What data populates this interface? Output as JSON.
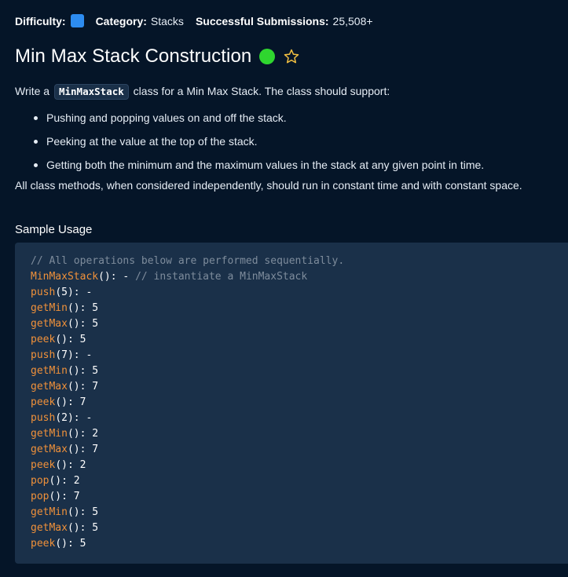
{
  "meta": {
    "difficulty_label": "Difficulty:",
    "category_label": "Category:",
    "category_value": "Stacks",
    "submissions_label": "Successful Submissions:",
    "submissions_value": "25,508+",
    "difficulty_color": "#2d8cf0"
  },
  "title": "Min Max Stack Construction",
  "status": {
    "completed_color": "#2fd62f",
    "favorite_icon": "star-outline-icon",
    "star_color": "#f5c242"
  },
  "description": {
    "intro_before": "Write a",
    "class_name": "MinMaxStack",
    "intro_after": "class for a Min Max Stack. The class should support:",
    "features": [
      "Pushing and popping values on and off the stack.",
      "Peeking at the value at the top of the stack.",
      "Getting both the minimum and the maximum values in the stack at any given point in time."
    ],
    "closing": "All class methods, when considered independently, should run in constant time and with constant space."
  },
  "sample_usage": {
    "heading": "Sample Usage",
    "comment": "// All operations below are performed sequentially.",
    "lines": [
      {
        "fn": "MinMaxStack",
        "result": "-",
        "note": "// instantiate a MinMaxStack"
      },
      {
        "fn": "push",
        "arg": "5",
        "result": "-"
      },
      {
        "fn": "getMin",
        "result": "5"
      },
      {
        "fn": "getMax",
        "result": "5"
      },
      {
        "fn": "peek",
        "result": "5"
      },
      {
        "fn": "push",
        "arg": "7",
        "result": "-"
      },
      {
        "fn": "getMin",
        "result": "5"
      },
      {
        "fn": "getMax",
        "result": "7"
      },
      {
        "fn": "peek",
        "result": "7"
      },
      {
        "fn": "push",
        "arg": "2",
        "result": "-"
      },
      {
        "fn": "getMin",
        "result": "2"
      },
      {
        "fn": "getMax",
        "result": "7"
      },
      {
        "fn": "peek",
        "result": "2"
      },
      {
        "fn": "pop",
        "result": "2"
      },
      {
        "fn": "pop",
        "result": "7"
      },
      {
        "fn": "getMin",
        "result": "5"
      },
      {
        "fn": "getMax",
        "result": "5"
      },
      {
        "fn": "peek",
        "result": "5"
      }
    ]
  }
}
